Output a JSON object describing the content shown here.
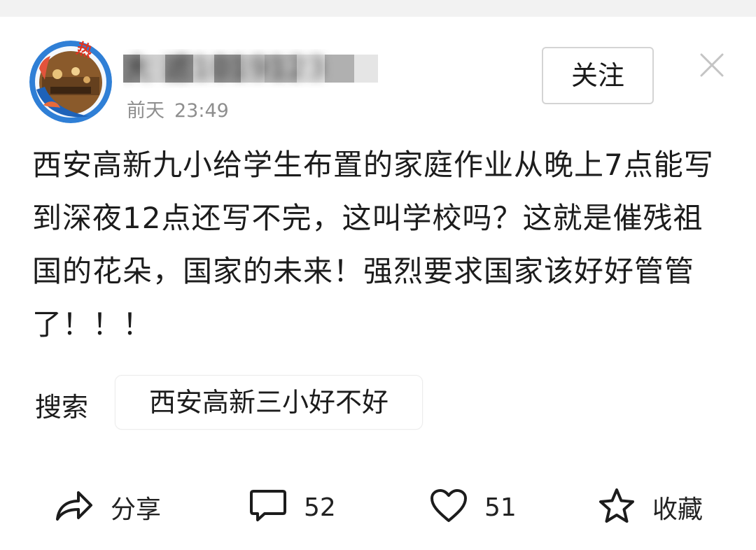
{
  "post": {
    "author_name": "大 滤1019123",
    "time_day": "前天",
    "time_clock": "23:49",
    "avatar_badge": "热",
    "follow_label": "关注",
    "text": "西安高新九小给学生布置的家庭作业从晚上7点能写到深夜12点还写不完，这叫学校吗？这就是催残祖国的花朵，国家的未来！强烈要求国家该好好管管了！！！"
  },
  "search": {
    "label": "搜索",
    "chip": "西安高新三小好不好"
  },
  "actions": {
    "share_label": "分享",
    "comment_count": "52",
    "like_count": "51",
    "favorite_label": "收藏"
  },
  "colors": {
    "background": "#ffffff",
    "top_strip": "#f2f2f2",
    "meta_text": "#8e8e8e",
    "avatar_ring": "#2f7fd6"
  },
  "icons": {
    "close": "close-icon",
    "share": "share-arrow-icon",
    "comment": "comment-bubble-icon",
    "like": "heart-icon",
    "favorite": "star-icon"
  }
}
